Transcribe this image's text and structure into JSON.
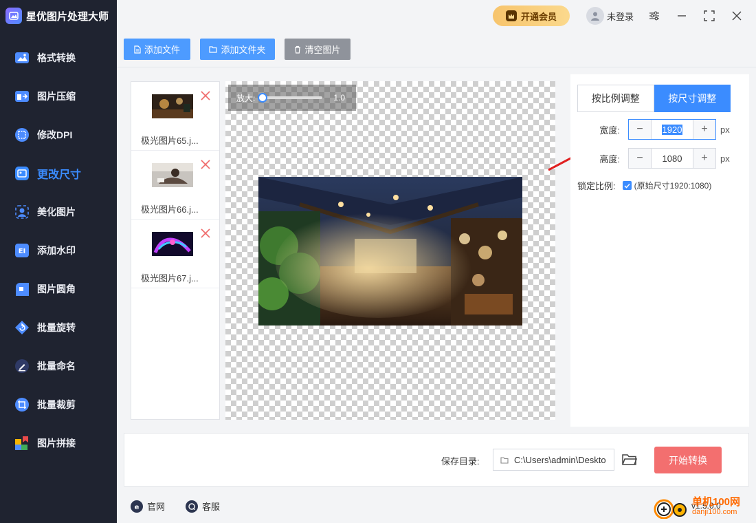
{
  "app": {
    "title": "星优图片处理大师"
  },
  "sidebar": {
    "items": [
      {
        "label": "格式转换",
        "color": "#4d8cff"
      },
      {
        "label": "图片压缩",
        "color": "#4d8cff"
      },
      {
        "label": "修改DPI",
        "color": "#4d8cff"
      },
      {
        "label": "更改尺寸",
        "color": "#3b8cff",
        "active": true
      },
      {
        "label": "美化图片",
        "color": "#4d8cff"
      },
      {
        "label": "添加水印",
        "color": "#4d8cff"
      },
      {
        "label": "图片圆角",
        "color": "#4d8cff"
      },
      {
        "label": "批量旋转",
        "color": "#4d8cff"
      },
      {
        "label": "批量命名",
        "color": "#4d8cff"
      },
      {
        "label": "批量裁剪",
        "color": "#4d8cff"
      },
      {
        "label": "图片拼接",
        "color": "#e84a4a"
      }
    ]
  },
  "header": {
    "vip_label": "开通会员",
    "user_label": "未登录"
  },
  "toolbar": {
    "add_file": "添加文件",
    "add_folder": "添加文件夹",
    "clear": "清空图片"
  },
  "files": [
    {
      "name": "极光图片65.j..."
    },
    {
      "name": "极光图片66.j..."
    },
    {
      "name": "极光图片67.j..."
    }
  ],
  "preview": {
    "zoom_label": "放大:",
    "zoom_value": "1.0",
    "zoom_level": 0.0
  },
  "settings": {
    "tab_ratio": "按比例调整",
    "tab_size": "按尺寸调整",
    "width_label": "宽度:",
    "width_value": "1920",
    "height_label": "高度:",
    "height_value": "1080",
    "unit": "px",
    "lock_label": "锁定比例:",
    "lock_note": "(原始尺寸1920:1080)",
    "lock_checked": true
  },
  "save": {
    "label": "保存目录:",
    "path": "C:\\Users\\admin\\Deskto",
    "start": "开始转换"
  },
  "footer": {
    "website": "官网",
    "support": "客服",
    "version": "v1.5.0.0",
    "watermark_cn": "单机100网",
    "watermark_url": "danji100.com"
  },
  "colors": {
    "accent": "#3b8cff",
    "sidebar_bg": "#1f2330",
    "start_btn": "#f36f6f",
    "vip": "#f7c46c"
  }
}
